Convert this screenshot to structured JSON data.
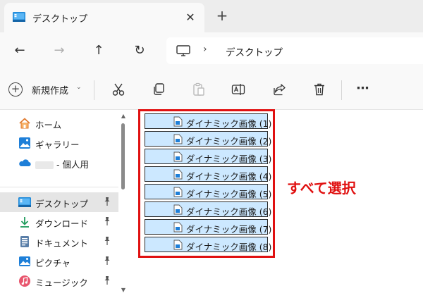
{
  "tab": {
    "title": "デスクトップ",
    "close_glyph": "✕",
    "new_tab_glyph": "+"
  },
  "nav": {
    "back": "←",
    "forward": "→",
    "up": "↑",
    "refresh": "↻"
  },
  "address": {
    "separator": "›",
    "location": "デスクトップ"
  },
  "commands": {
    "new_label": "新規作成",
    "new_caret": "⌄",
    "more": "⋯"
  },
  "sidebar": {
    "items": [
      {
        "label": "ホーム",
        "icon": "home-icon"
      },
      {
        "label": "ギャラリー",
        "icon": "gallery-icon"
      },
      {
        "label": "- 個人用",
        "icon": "onedrive-cloud-icon"
      },
      {
        "label": "デスクトップ",
        "icon": "desktop-icon",
        "pinned": true,
        "selected": true
      },
      {
        "label": "ダウンロード",
        "icon": "download-icon",
        "pinned": true
      },
      {
        "label": "ドキュメント",
        "icon": "documents-icon",
        "pinned": true
      },
      {
        "label": "ピクチャ",
        "icon": "pictures-icon",
        "pinned": true
      },
      {
        "label": "ミュージック",
        "icon": "music-icon",
        "pinned": true
      }
    ]
  },
  "files": [
    {
      "name": "ダイナミック画像 (1)"
    },
    {
      "name": "ダイナミック画像 (2)"
    },
    {
      "name": "ダイナミック画像 (3)"
    },
    {
      "name": "ダイナミック画像 (4)"
    },
    {
      "name": "ダイナミック画像 (5)"
    },
    {
      "name": "ダイナミック画像 (6)"
    },
    {
      "name": "ダイナミック画像 (7)"
    },
    {
      "name": "ダイナミック画像 (8)"
    }
  ],
  "annotation": {
    "text": "すべて選択",
    "color": "#e01010"
  },
  "colors": {
    "selection": "#cce8ff",
    "accent": "#0067c0"
  }
}
